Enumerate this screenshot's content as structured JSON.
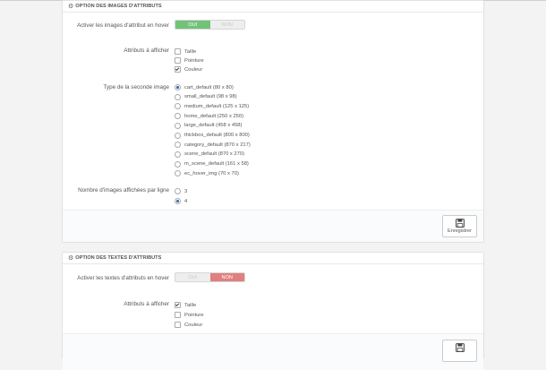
{
  "images_panel": {
    "title": "OPTION DES IMAGES D'ATTRIBUTS",
    "hover_label": "Activer les images d'attribut en hover",
    "hover_toggle": {
      "yes": "OUI",
      "no": "NON",
      "value": "OUI"
    },
    "attributes_label": "Attributs à afficher",
    "attributes": [
      {
        "label": "Taille",
        "checked": false
      },
      {
        "label": "Pointure",
        "checked": false
      },
      {
        "label": "Couleur",
        "checked": true
      }
    ],
    "second_image_label": "Type de la seconde image",
    "image_types": [
      {
        "label": "cart_default (80 x 80)",
        "checked": true
      },
      {
        "label": "small_default (98 x 98)",
        "checked": false
      },
      {
        "label": "medium_default (125 x 125)",
        "checked": false
      },
      {
        "label": "home_default (250 x 250)",
        "checked": false
      },
      {
        "label": "large_default (458 x 458)",
        "checked": false
      },
      {
        "label": "thickbox_default (800 x 800)",
        "checked": false
      },
      {
        "label": "category_default (870 x 217)",
        "checked": false
      },
      {
        "label": "scene_default (870 x 270)",
        "checked": false
      },
      {
        "label": "m_scene_default (161 x 58)",
        "checked": false
      },
      {
        "label": "ec_hover_img (70 x 70)",
        "checked": false
      }
    ],
    "per_line_label": "Nombre d'images affichées par ligne",
    "per_line_options": [
      {
        "label": "3",
        "checked": false
      },
      {
        "label": "4",
        "checked": true
      }
    ],
    "save_label": "Enregistrer"
  },
  "texts_panel": {
    "title": "OPTION DES TEXTES D'ATTRIBUTS",
    "hover_label": "Activer les textes d'attributs en hover",
    "hover_toggle": {
      "yes": "OUI",
      "no": "NON",
      "value": "NON"
    },
    "attributes_label": "Attributs à afficher",
    "attributes": [
      {
        "label": "Taille",
        "checked": true
      },
      {
        "label": "Pointure",
        "checked": false
      },
      {
        "label": "Couleur",
        "checked": false
      }
    ]
  },
  "colors": {
    "toggle_on_green": "#72c279",
    "toggle_on_red": "#e07f7f",
    "radio_selected": "#2f6db5"
  },
  "icons": {
    "panel_heading": "cogs-icon",
    "save": "floppy-disk-icon"
  }
}
